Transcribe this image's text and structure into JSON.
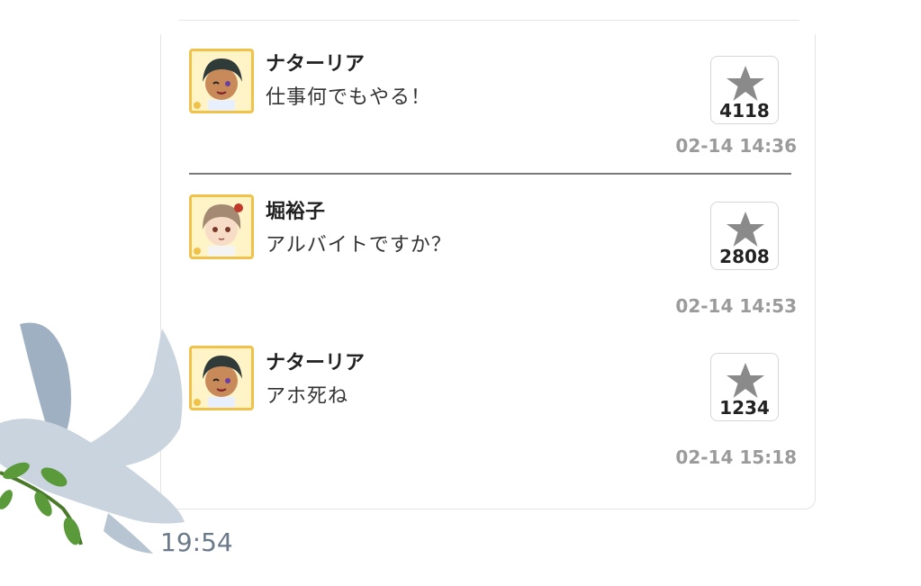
{
  "messages": [
    {
      "author": "ナターリア",
      "text": "仕事何でもやる！",
      "star_count": "4118",
      "timestamp": "02-14 14:36"
    },
    {
      "author": "堀裕子",
      "text": "アルバイトですか？",
      "star_count": "2808",
      "timestamp": "02-14 14:53"
    },
    {
      "author": "ナターリア",
      "text": "アホ死ね",
      "star_count": "1234",
      "timestamp": "02-14 15:18"
    }
  ],
  "status_time": "19:54",
  "colors": {
    "avatar_border": "#f0c24a",
    "star": "#8a8a8a",
    "timestamp": "#9b9b9b",
    "clock": "#6b7a8a",
    "dove_body": "#c9d4df",
    "leaf": "#5a9a3a"
  },
  "icons": [
    "star-icon",
    "avatar-image",
    "dove-icon"
  ]
}
